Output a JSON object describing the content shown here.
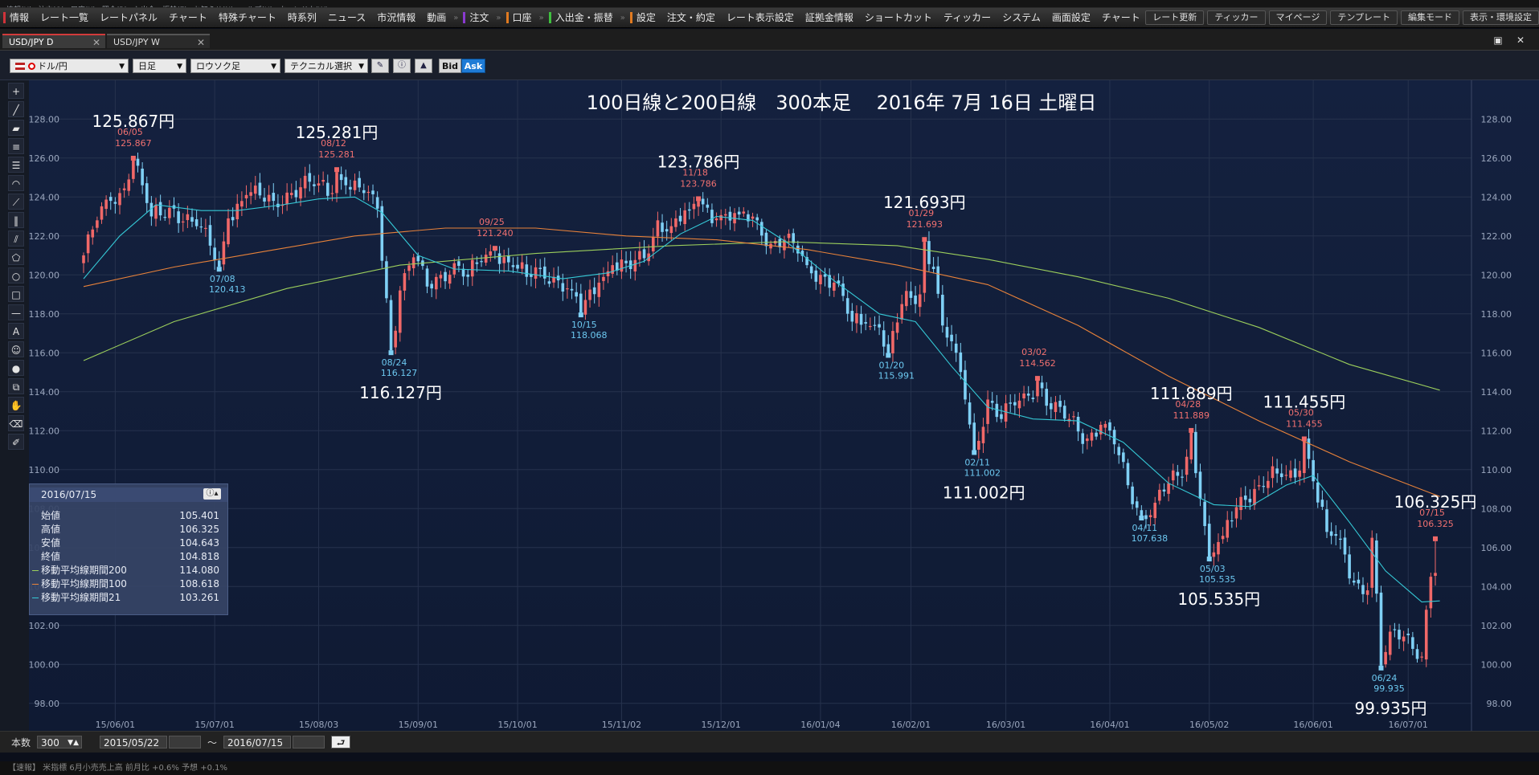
{
  "menubar": [
    "情報(H)",
    "注文(O)",
    "口座(K)",
    "照会(R)",
    "入出金・振替(E)",
    "お知らせ(N)",
    "ヘルプ(H)",
    "ウィンドウ(W)"
  ],
  "toolbar": {
    "items": [
      {
        "label": "情報",
        "accent": "#d0333a"
      },
      {
        "label": "レート一覧"
      },
      {
        "label": "レートパネル"
      },
      {
        "label": "チャート"
      },
      {
        "label": "特殊チャート"
      },
      {
        "label": "時系列"
      },
      {
        "label": "ニュース"
      },
      {
        "label": "市況情報"
      },
      {
        "label": "動画"
      },
      {
        "sep": true
      },
      {
        "label": "注文",
        "accent": "#8a3ad0"
      },
      {
        "sep": true
      },
      {
        "label": "口座",
        "accent": "#e07a20"
      },
      {
        "sep": true
      },
      {
        "label": "入出金・振替",
        "accent": "#3fbf3f"
      },
      {
        "sep": true
      },
      {
        "label": "設定",
        "accent": "#e07a20"
      },
      {
        "label": "注文・約定"
      },
      {
        "label": "レート表示設定"
      },
      {
        "label": "証拠金情報"
      },
      {
        "label": "ショートカット"
      },
      {
        "label": "ティッカー"
      },
      {
        "label": "システム"
      },
      {
        "label": "画面設定"
      },
      {
        "label": "チャート"
      }
    ],
    "right": [
      "レート更新",
      "ティッカー",
      "マイページ",
      "テンプレート",
      "編集モード",
      "表示・環境設定"
    ]
  },
  "tabs": [
    {
      "label": "USD/JPY D",
      "active": true
    },
    {
      "label": "USD/JPY W",
      "active": false
    }
  ],
  "controls": {
    "pair": "ドル/円",
    "period": "日足",
    "chart_type": "ロウソク足",
    "technical": "テクニカル選択",
    "bid": "Bid",
    "ask": "Ask"
  },
  "chart_data": {
    "type": "candlestick",
    "title": "100日線と200日線　300本足　 2016年 7月 16日 土曜日",
    "ylim": [
      97,
      129
    ],
    "y_ticks": [
      "128.00",
      "126.00",
      "124.00",
      "122.00",
      "120.00",
      "118.00",
      "116.00",
      "114.00",
      "112.00",
      "110.00",
      "108.00",
      "106.00",
      "104.00",
      "102.00",
      "100.00",
      "98.00"
    ],
    "x_ticks": [
      "15/06/01",
      "15/07/01",
      "15/08/03",
      "15/09/01",
      "15/10/01",
      "15/11/02",
      "15/12/01",
      "16/01/04",
      "16/02/01",
      "16/03/01",
      "16/04/01",
      "16/05/02",
      "16/06/01",
      "16/07/01"
    ],
    "x_tick_index": [
      7,
      29,
      52,
      74,
      96,
      119,
      141,
      163,
      183,
      204,
      227,
      249,
      272,
      293
    ],
    "n_bars": 300,
    "colors": {
      "up": "#f06868",
      "down": "#7fd0f5",
      "ma21": "#35c9d6",
      "ma100": "#e8823a",
      "ma200": "#9ccf5c"
    },
    "path_closes": [
      [
        0,
        121.0
      ],
      [
        3,
        122.8
      ],
      [
        6,
        123.8
      ],
      [
        8,
        124.2
      ],
      [
        10,
        124.9
      ],
      [
        11,
        125.867
      ],
      [
        13,
        124.6
      ],
      [
        15,
        123.0
      ],
      [
        20,
        123.4
      ],
      [
        25,
        122.5
      ],
      [
        28,
        121.5
      ],
      [
        30,
        120.413
      ],
      [
        32,
        122.9
      ],
      [
        36,
        124.1
      ],
      [
        42,
        123.8
      ],
      [
        48,
        124.5
      ],
      [
        52,
        124.7
      ],
      [
        55,
        124.2
      ],
      [
        56,
        125.281
      ],
      [
        58,
        124.6
      ],
      [
        62,
        124.2
      ],
      [
        65,
        123.4
      ],
      [
        67,
        118.8
      ],
      [
        68,
        116.127
      ],
      [
        70,
        119.2
      ],
      [
        73,
        120.9
      ],
      [
        76,
        119.4
      ],
      [
        79,
        120.0
      ],
      [
        82,
        120.6
      ],
      [
        85,
        119.9
      ],
      [
        88,
        120.7
      ],
      [
        91,
        121.24
      ],
      [
        95,
        120.4
      ],
      [
        98,
        119.9
      ],
      [
        101,
        120.3
      ],
      [
        104,
        119.9
      ],
      [
        108,
        119.2
      ],
      [
        110,
        118.068
      ],
      [
        114,
        119.6
      ],
      [
        117,
        120.5
      ],
      [
        121,
        120.3
      ],
      [
        125,
        121.1
      ],
      [
        127,
        122.8
      ],
      [
        130,
        122.5
      ],
      [
        134,
        123.3
      ],
      [
        136,
        123.786
      ],
      [
        140,
        122.9
      ],
      [
        145,
        123.1
      ],
      [
        149,
        122.8
      ],
      [
        152,
        121.6
      ],
      [
        155,
        121.8
      ],
      [
        158,
        121.1
      ],
      [
        160,
        120.5
      ],
      [
        163,
        120.0
      ],
      [
        166,
        119.6
      ],
      [
        170,
        117.6
      ],
      [
        173,
        117.5
      ],
      [
        176,
        117.3
      ],
      [
        178,
        115.991
      ],
      [
        181,
        118.5
      ],
      [
        185,
        119.0
      ],
      [
        186,
        121.693
      ],
      [
        188,
        120.3
      ],
      [
        190,
        117.4
      ],
      [
        193,
        116.0
      ],
      [
        195,
        113.6
      ],
      [
        197,
        111.002
      ],
      [
        200,
        113.6
      ],
      [
        203,
        112.6
      ],
      [
        206,
        113.3
      ],
      [
        209,
        113.8
      ],
      [
        211,
        114.562
      ],
      [
        214,
        113.1
      ],
      [
        218,
        112.6
      ],
      [
        222,
        111.6
      ],
      [
        225,
        112.3
      ],
      [
        228,
        111.3
      ],
      [
        231,
        109.2
      ],
      [
        234,
        107.638
      ],
      [
        237,
        108.3
      ],
      [
        240,
        109.3
      ],
      [
        243,
        109.6
      ],
      [
        245,
        111.889
      ],
      [
        247,
        108.5
      ],
      [
        249,
        105.535
      ],
      [
        252,
        106.6
      ],
      [
        256,
        108.6
      ],
      [
        260,
        109.2
      ],
      [
        264,
        109.8
      ],
      [
        268,
        109.6
      ],
      [
        270,
        111.455
      ],
      [
        272,
        109.4
      ],
      [
        275,
        106.8
      ],
      [
        278,
        106.4
      ],
      [
        281,
        104.2
      ],
      [
        284,
        103.8
      ],
      [
        285,
        106.5
      ],
      [
        287,
        99.935
      ],
      [
        290,
        101.8
      ],
      [
        293,
        101.5
      ],
      [
        296,
        100.4
      ],
      [
        298,
        104.5
      ],
      [
        300,
        104.818
      ]
    ],
    "ma200": [
      [
        0,
        115.6
      ],
      [
        20,
        117.6
      ],
      [
        45,
        119.3
      ],
      [
        70,
        120.5
      ],
      [
        100,
        121.1
      ],
      [
        130,
        121.5
      ],
      [
        155,
        121.7
      ],
      [
        180,
        121.5
      ],
      [
        200,
        120.8
      ],
      [
        220,
        119.9
      ],
      [
        240,
        118.8
      ],
      [
        260,
        117.3
      ],
      [
        280,
        115.4
      ],
      [
        300,
        114.08
      ]
    ],
    "ma100": [
      [
        0,
        119.4
      ],
      [
        20,
        120.4
      ],
      [
        40,
        121.2
      ],
      [
        60,
        122.0
      ],
      [
        80,
        122.4
      ],
      [
        100,
        122.4
      ],
      [
        120,
        122.0
      ],
      [
        140,
        121.8
      ],
      [
        160,
        121.3
      ],
      [
        180,
        120.5
      ],
      [
        200,
        119.5
      ],
      [
        220,
        117.4
      ],
      [
        240,
        114.8
      ],
      [
        260,
        112.5
      ],
      [
        280,
        110.4
      ],
      [
        300,
        108.618
      ]
    ],
    "ma21": [
      [
        0,
        119.8
      ],
      [
        8,
        122.0
      ],
      [
        16,
        123.6
      ],
      [
        26,
        123.3
      ],
      [
        34,
        123.3
      ],
      [
        44,
        123.6
      ],
      [
        52,
        123.9
      ],
      [
        60,
        124.0
      ],
      [
        66,
        123.2
      ],
      [
        74,
        121.0
      ],
      [
        82,
        120.3
      ],
      [
        94,
        120.2
      ],
      [
        106,
        119.8
      ],
      [
        116,
        120.1
      ],
      [
        124,
        120.7
      ],
      [
        132,
        122.1
      ],
      [
        140,
        123.0
      ],
      [
        148,
        122.8
      ],
      [
        156,
        121.6
      ],
      [
        166,
        119.7
      ],
      [
        176,
        118.0
      ],
      [
        184,
        117.6
      ],
      [
        192,
        115.3
      ],
      [
        200,
        113.2
      ],
      [
        210,
        112.6
      ],
      [
        220,
        112.5
      ],
      [
        230,
        111.4
      ],
      [
        240,
        109.3
      ],
      [
        250,
        108.2
      ],
      [
        258,
        108.1
      ],
      [
        266,
        109.2
      ],
      [
        272,
        109.7
      ],
      [
        280,
        107.3
      ],
      [
        288,
        104.8
      ],
      [
        296,
        103.2
      ],
      [
        300,
        103.261
      ]
    ],
    "markers": [
      {
        "i": 11,
        "price": 125.867,
        "date": "06/05",
        "type": "high",
        "big": "125.867円"
      },
      {
        "i": 30,
        "price": 120.413,
        "date": "07/08",
        "type": "low"
      },
      {
        "i": 56,
        "price": 125.281,
        "date": "08/12",
        "type": "high",
        "big": "125.281円"
      },
      {
        "i": 68,
        "price": 116.127,
        "date": "08/24",
        "type": "low",
        "big": "116.127円"
      },
      {
        "i": 91,
        "price": 121.24,
        "date": "09/25",
        "type": "high"
      },
      {
        "i": 110,
        "price": 118.068,
        "date": "10/15",
        "type": "low"
      },
      {
        "i": 136,
        "price": 123.786,
        "date": "11/18",
        "type": "high",
        "big": "123.786円"
      },
      {
        "i": 178,
        "price": 115.991,
        "date": "01/20",
        "type": "low"
      },
      {
        "i": 186,
        "price": 121.693,
        "date": "01/29",
        "type": "high",
        "big": "121.693円"
      },
      {
        "i": 197,
        "price": 111.002,
        "date": "02/11",
        "type": "low",
        "big": "111.002円"
      },
      {
        "i": 211,
        "price": 114.562,
        "date": "03/02",
        "type": "high"
      },
      {
        "i": 234,
        "price": 107.638,
        "date": "04/11",
        "type": "low"
      },
      {
        "i": 245,
        "price": 111.889,
        "date": "04/28",
        "type": "high",
        "big": "111.889円"
      },
      {
        "i": 249,
        "price": 105.535,
        "date": "05/03",
        "type": "low",
        "big": "105.535円"
      },
      {
        "i": 270,
        "price": 111.455,
        "date": "05/30",
        "type": "high",
        "big": "111.455円"
      },
      {
        "i": 287,
        "price": 99.935,
        "date": "06/24",
        "type": "low",
        "big": "99.935円"
      },
      {
        "i": 299,
        "price": 106.325,
        "date": "07/15",
        "type": "high",
        "big": "106.325円"
      }
    ]
  },
  "info_panel": {
    "date": "2016/07/15",
    "rows": [
      {
        "label": "始値",
        "value": "105.401"
      },
      {
        "label": "高値",
        "value": "106.325"
      },
      {
        "label": "安値",
        "value": "104.643"
      },
      {
        "label": "終値",
        "value": "104.818"
      },
      {
        "label": "移動平均線期間200",
        "value": "114.080",
        "color": "#9ccf5c"
      },
      {
        "label": "移動平均線期間100",
        "value": "108.618",
        "color": "#e8823a"
      },
      {
        "label": "移動平均線期間21",
        "value": "103.261",
        "color": "#35c9d6"
      }
    ]
  },
  "bottom": {
    "count_label": "本数",
    "count_value": "300",
    "from_date": "2015/05/22",
    "tilde": "〜",
    "to_date": "2016/07/15"
  },
  "status_text": "【速報】 米指標 6月小売売上高 前月比 +0.6% 予想 +0.1%"
}
